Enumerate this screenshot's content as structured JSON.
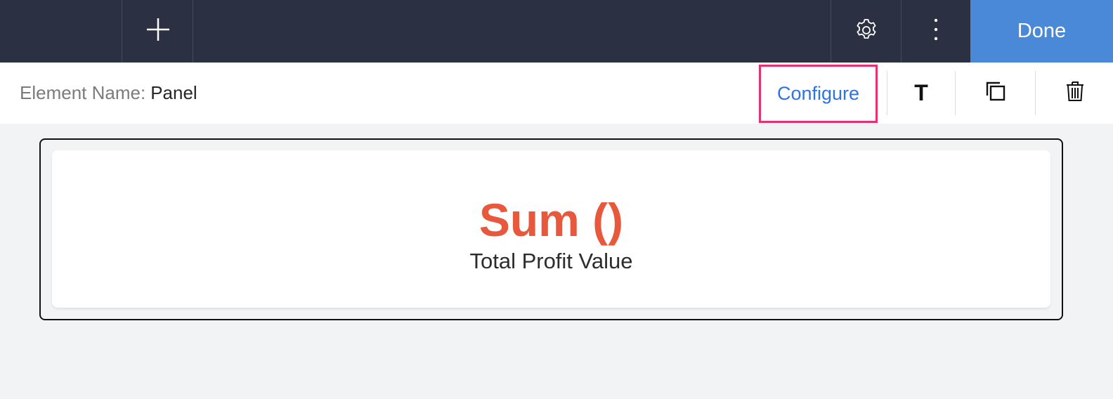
{
  "topbar": {
    "add_icon": "plus-icon",
    "settings_icon": "gear-icon",
    "more_icon": "vertical-ellipsis-icon",
    "done_label": "Done",
    "background": "#2b3142",
    "done_color": "#4a88d8"
  },
  "toolbar": {
    "element_name_label": "Element Name:",
    "element_name_value": "Panel",
    "configure_label": "Configure",
    "configure_highlight": "#e8306e",
    "text_icon_glyph": "T",
    "text_icon": "text-format-icon",
    "duplicate_icon": "duplicate-icon",
    "delete_icon": "trash-icon"
  },
  "panel": {
    "value": "Sum ()",
    "value_color": "#e8583d",
    "label": "Total Profit Value"
  }
}
